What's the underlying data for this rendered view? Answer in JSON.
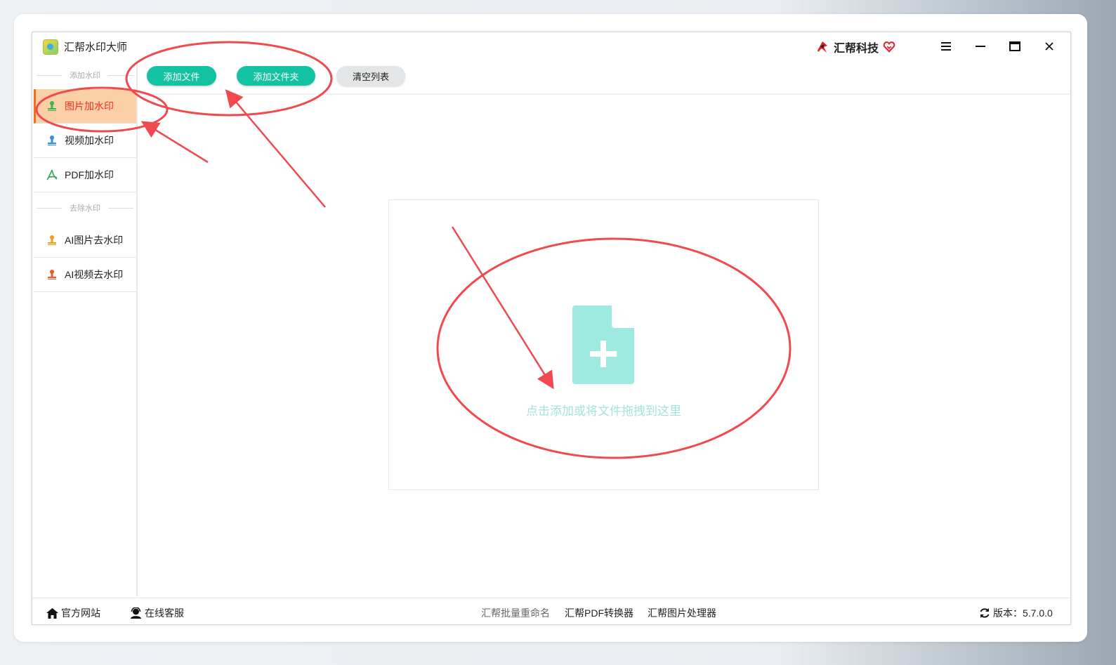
{
  "window": {
    "title": "汇帮水印大师",
    "brand": "汇帮科技"
  },
  "toolbar": {
    "add_file": "添加文件",
    "add_folder": "添加文件夹",
    "clear_list": "清空列表"
  },
  "sidebar": {
    "add_section": "添加水印",
    "remove_section": "去除水印",
    "items": [
      {
        "label": "图片加水印",
        "icon": "image-watermark-icon",
        "active": true
      },
      {
        "label": "视频加水印",
        "icon": "video-watermark-icon"
      },
      {
        "label": "PDF加水印",
        "icon": "pdf-icon"
      },
      {
        "label": "AI图片去水印",
        "icon": "ai-image-remove-icon"
      },
      {
        "label": "AI视频去水印",
        "icon": "ai-video-remove-icon"
      }
    ]
  },
  "main": {
    "drop_text": "点击添加或将文件拖拽到这里"
  },
  "footer": {
    "website": "官方网站",
    "service": "在线客服",
    "rename": "汇帮批量重命名",
    "pdf_converter": "汇帮PDF转换器",
    "image_processor": "汇帮图片处理器",
    "version": "版本：5.7.0.0"
  },
  "colors": {
    "accent_green": "#13c2a2",
    "active_bg": "#fbd0a7",
    "active_text": "#f52d1d",
    "annotation_red": "#f0494f",
    "drop_icon": "#9ee9e0"
  }
}
